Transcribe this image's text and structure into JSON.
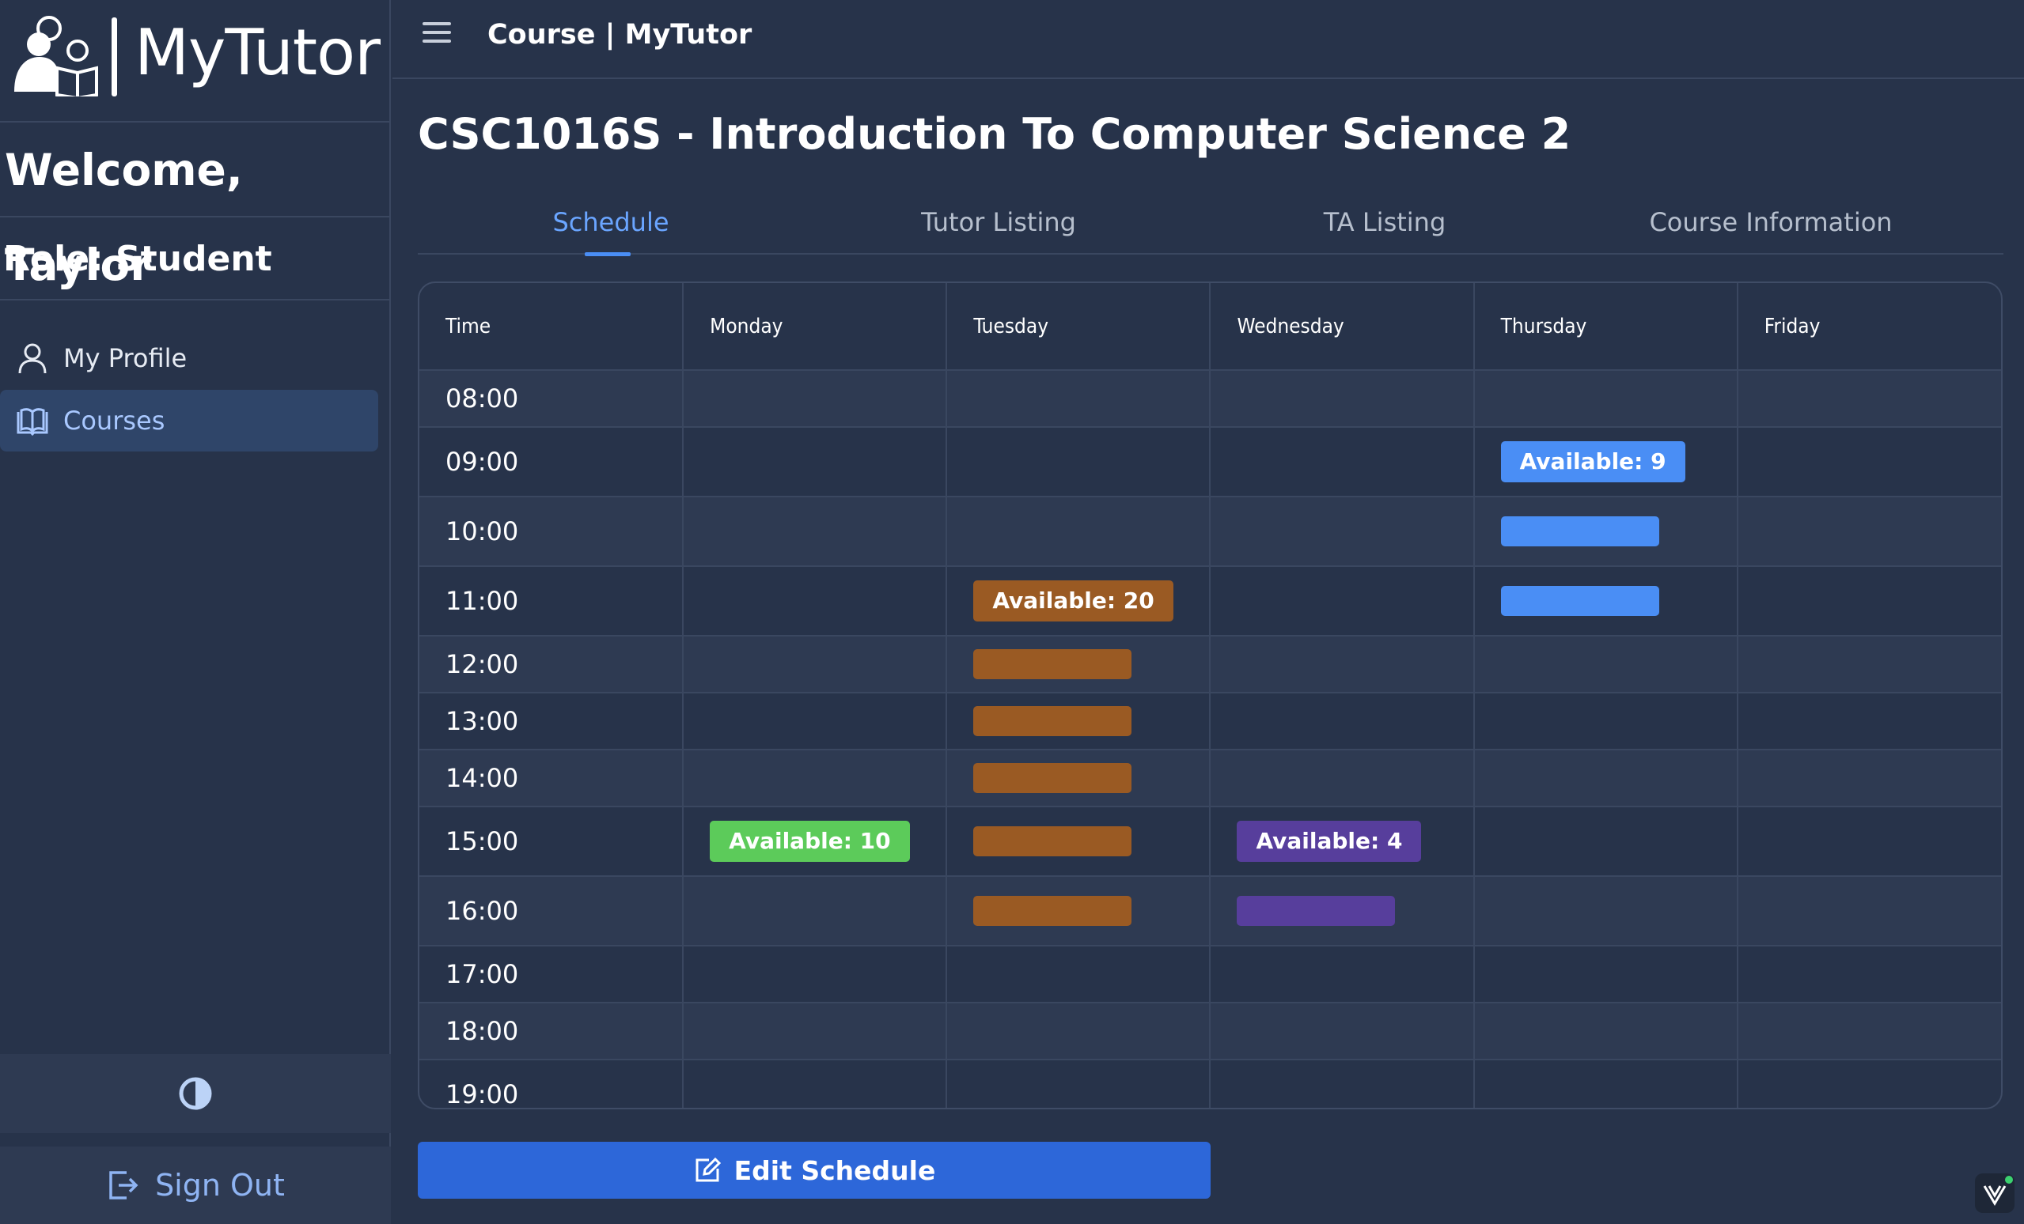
{
  "sidebar": {
    "brand_name": "MyTutor",
    "welcome": "Welcome, Taylor",
    "role": "Role: Student",
    "nav": [
      {
        "label": "My Profile",
        "icon": "user-icon"
      },
      {
        "label": "Courses",
        "icon": "book-icon",
        "active": true
      }
    ],
    "sign_out": "Sign Out"
  },
  "topbar": {
    "title": "Course | MyTutor"
  },
  "main": {
    "page_title": "CSC1016S - Introduction To Computer Science 2",
    "tabs": [
      "Schedule",
      "Tutor Listing",
      "TA Listing",
      "Course Information"
    ],
    "active_tab": "Schedule",
    "edit_button": "Edit Schedule"
  },
  "schedule": {
    "columns": [
      "Time",
      "Monday",
      "Tuesday",
      "Wednesday",
      "Thursday",
      "Friday"
    ],
    "times": [
      "08:00",
      "09:00",
      "10:00",
      "11:00",
      "12:00",
      "13:00",
      "14:00",
      "15:00",
      "16:00",
      "17:00",
      "18:00",
      "19:00"
    ],
    "slots": [
      {
        "day": "Thursday",
        "start": "09:00",
        "end": "12:00",
        "label": "Available: 9",
        "color": "#4a8ef5"
      },
      {
        "day": "Tuesday",
        "start": "11:00",
        "end": "17:00",
        "label": "Available: 20",
        "color": "#9a5a23"
      },
      {
        "day": "Monday",
        "start": "15:00",
        "end": "16:00",
        "label": "Available: 10",
        "color": "#5ccb5a"
      },
      {
        "day": "Wednesday",
        "start": "15:00",
        "end": "17:00",
        "label": "Available: 4",
        "color": "#573e9c"
      }
    ]
  },
  "colors": {
    "background": "#27334a",
    "accent": "#4a8ef5",
    "primary_button": "#2d67d9"
  }
}
